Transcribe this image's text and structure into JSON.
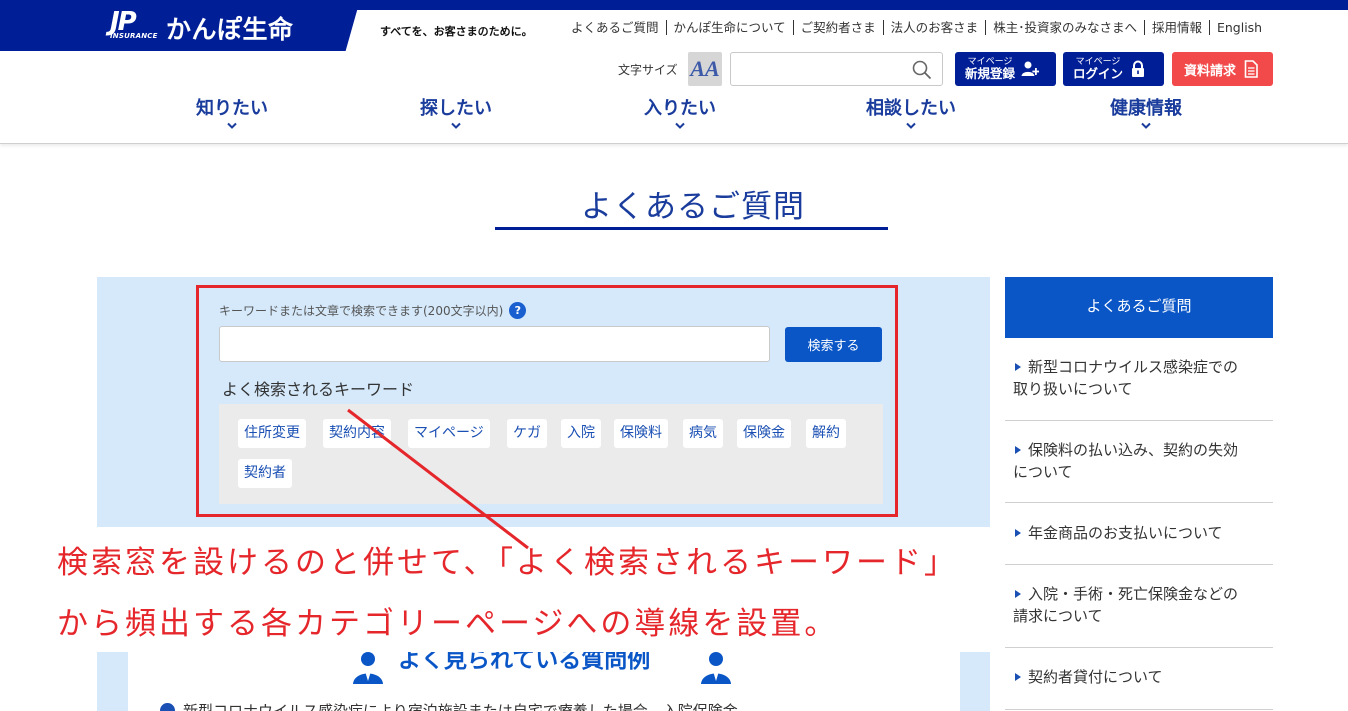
{
  "header": {
    "logo_mark": "JP",
    "logo_insurance": "INSURANCE",
    "logo_text": "かんぽ生命",
    "tagline": "すべてを、お客さまのために。",
    "util_links": [
      "よくあるご質問",
      "かんぽ生命について",
      "ご契約者さま",
      "法人のお客さま",
      "株主･投資家のみなさまへ",
      "採用情報",
      "English"
    ],
    "fontsize_label": "文字サイズ",
    "fontsize_glyph": "AA",
    "search_placeholder": "",
    "register": {
      "small": "マイページ",
      "big": "新規登録"
    },
    "login": {
      "small": "マイページ",
      "big": "ログイン"
    },
    "request_label": "資料請求"
  },
  "gnav": [
    "知りたい",
    "探したい",
    "入りたい",
    "相談したい",
    "健康情報"
  ],
  "page_title": "よくあるご質問",
  "search": {
    "label": "キーワードまたは文章で検索できます(200文字以内)",
    "help": "?",
    "value": "",
    "button": "検索する",
    "keywords_heading": "よく検索されるキーワード",
    "keywords": [
      "住所変更",
      "契約内容",
      "マイページ",
      "ケガ",
      "入院",
      "保険料",
      "病気",
      "保険金",
      "解約",
      "契約者"
    ]
  },
  "annotation": {
    "line1": "検索窓を設けるのと併せて、「よく検索されるキーワード」",
    "line2": "から頻出する各カテゴリーページへの導線を設置。"
  },
  "lower": {
    "heading": "よく見られている質問例",
    "first_item": "新型コロナウイルス感染症により宿泊施設または自宅で療養した場合、入院保険金"
  },
  "sidebar": {
    "header": "よくあるご質問",
    "items": [
      {
        "l1": "新型コロナウイルス感染症での",
        "l2": "取り扱いについて"
      },
      {
        "l1": "保険料の払い込み、契約の失効",
        "l2": "について"
      },
      {
        "l1": "年金商品のお支払いについて",
        "l2": ""
      },
      {
        "l1": "入院・手術・死亡保険金などの",
        "l2": "請求について"
      },
      {
        "l1": "契約者貸付について",
        "l2": ""
      }
    ]
  },
  "colors": {
    "brand_navy": "#001e96",
    "accent_blue": "#0a56c7",
    "annotation_red": "#e5262b",
    "panel_blue": "#d5e9fb"
  }
}
